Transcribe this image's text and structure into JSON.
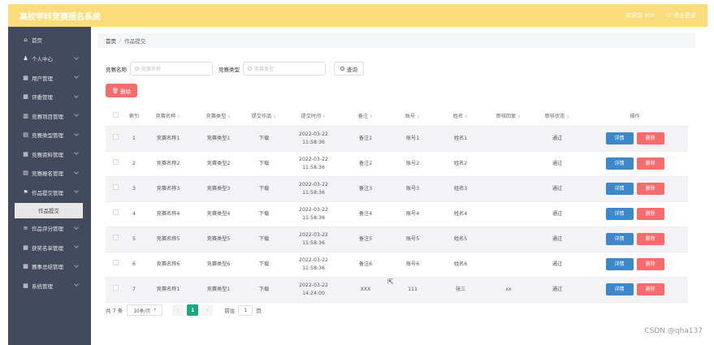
{
  "app": {
    "title": "高校学科竞赛报名系统",
    "user": "欢迎您 abo",
    "logout": "退出登录"
  },
  "sidebar": {
    "items": [
      {
        "icon": "⌂",
        "label": "首页",
        "expandable": false
      },
      {
        "icon": "♟",
        "label": "个人中心",
        "expandable": true
      },
      {
        "icon": "▦",
        "label": "用户管理",
        "expandable": true
      },
      {
        "icon": "▦",
        "label": "评委管理",
        "expandable": true
      },
      {
        "icon": "▥",
        "label": "竞赛项目管理",
        "expandable": true
      },
      {
        "icon": "▤",
        "label": "竞赛类型管理",
        "expandable": true
      },
      {
        "icon": "▦",
        "label": "竞赛资料管理",
        "expandable": true
      },
      {
        "icon": "▤",
        "label": "竞赛报名管理",
        "expandable": true
      },
      {
        "icon": "⚑",
        "label": "作品提交管理",
        "expandable": true
      },
      {
        "icon": "≡",
        "label": "作品评分管理",
        "expandable": true
      },
      {
        "icon": "▦",
        "label": "获奖名单管理",
        "expandable": true
      },
      {
        "icon": "▦",
        "label": "赛事总结管理",
        "expandable": true
      },
      {
        "icon": "▦",
        "label": "系统管理",
        "expandable": true
      }
    ],
    "active_sub": "作品提交"
  },
  "breadcrumb": {
    "home": "首页",
    "current": "作品提交"
  },
  "search": {
    "name_label": "竞赛名称",
    "name_placeholder": "竞赛名称",
    "type_label": "竞赛类型",
    "type_placeholder": "竞赛类型",
    "query_button": "查询"
  },
  "actions": {
    "delete_button": "删除"
  },
  "table": {
    "headers": [
      "索引",
      "竞赛名称",
      "竞赛类型",
      "提交作品",
      "提交时间",
      "备注",
      "账号",
      "姓名",
      "审核回复",
      "审核状态",
      "操作"
    ],
    "rows": [
      {
        "index": "1",
        "name": "竞赛名称1",
        "type": "竞赛类型1",
        "file": "下载",
        "time": "2022-03-22 11:58:36",
        "remark": "备注1",
        "account": "账号1",
        "person": "姓名1",
        "reply": "",
        "status": "通过"
      },
      {
        "index": "2",
        "name": "竞赛名称2",
        "type": "竞赛类型2",
        "file": "下载",
        "time": "2022-03-22 11:58:36",
        "remark": "备注2",
        "account": "账号2",
        "person": "姓名2",
        "reply": "",
        "status": "通过"
      },
      {
        "index": "3",
        "name": "竞赛名称3",
        "type": "竞赛类型3",
        "file": "下载",
        "time": "2022-03-22 11:58:36",
        "remark": "备注3",
        "account": "账号3",
        "person": "姓名3",
        "reply": "",
        "status": "通过"
      },
      {
        "index": "4",
        "name": "竞赛名称4",
        "type": "竞赛类型4",
        "file": "下载",
        "time": "2022-03-22 11:58:36",
        "remark": "备注4",
        "account": "账号4",
        "person": "姓名4",
        "reply": "",
        "status": "通过"
      },
      {
        "index": "5",
        "name": "竞赛名称5",
        "type": "竞赛类型5",
        "file": "下载",
        "time": "2022-03-22 11:58:36",
        "remark": "备注5",
        "account": "账号5",
        "person": "姓名5",
        "reply": "",
        "status": "通过"
      },
      {
        "index": "6",
        "name": "竞赛名称6",
        "type": "竞赛类型6",
        "file": "下载",
        "time": "2022-03-22 11:58:36",
        "remark": "备注6",
        "account": "账号6",
        "person": "姓名6",
        "reply": "",
        "status": "通过"
      },
      {
        "index": "7",
        "name": "竞赛名称1",
        "type": "竞赛类型1",
        "file": "下载",
        "time": "2022-03-22 14:24:00",
        "remark": "XXX",
        "account": "111",
        "person": "张三",
        "reply": "xx",
        "status": "通过"
      }
    ],
    "detail_button": "详情",
    "delete_button": "删除"
  },
  "pagination": {
    "total": "共 7 条",
    "page_size": "10条/页",
    "current_page": "1",
    "goto_label": "前往",
    "goto_value": "1",
    "goto_suffix": "页"
  },
  "watermark": "CSDN @qha137",
  "colors": {
    "topbar": "#fbdc7a",
    "sidebar": "#434a5d",
    "danger": "#f56c6c",
    "primary": "#3e88c9",
    "success": "#1ba784"
  }
}
